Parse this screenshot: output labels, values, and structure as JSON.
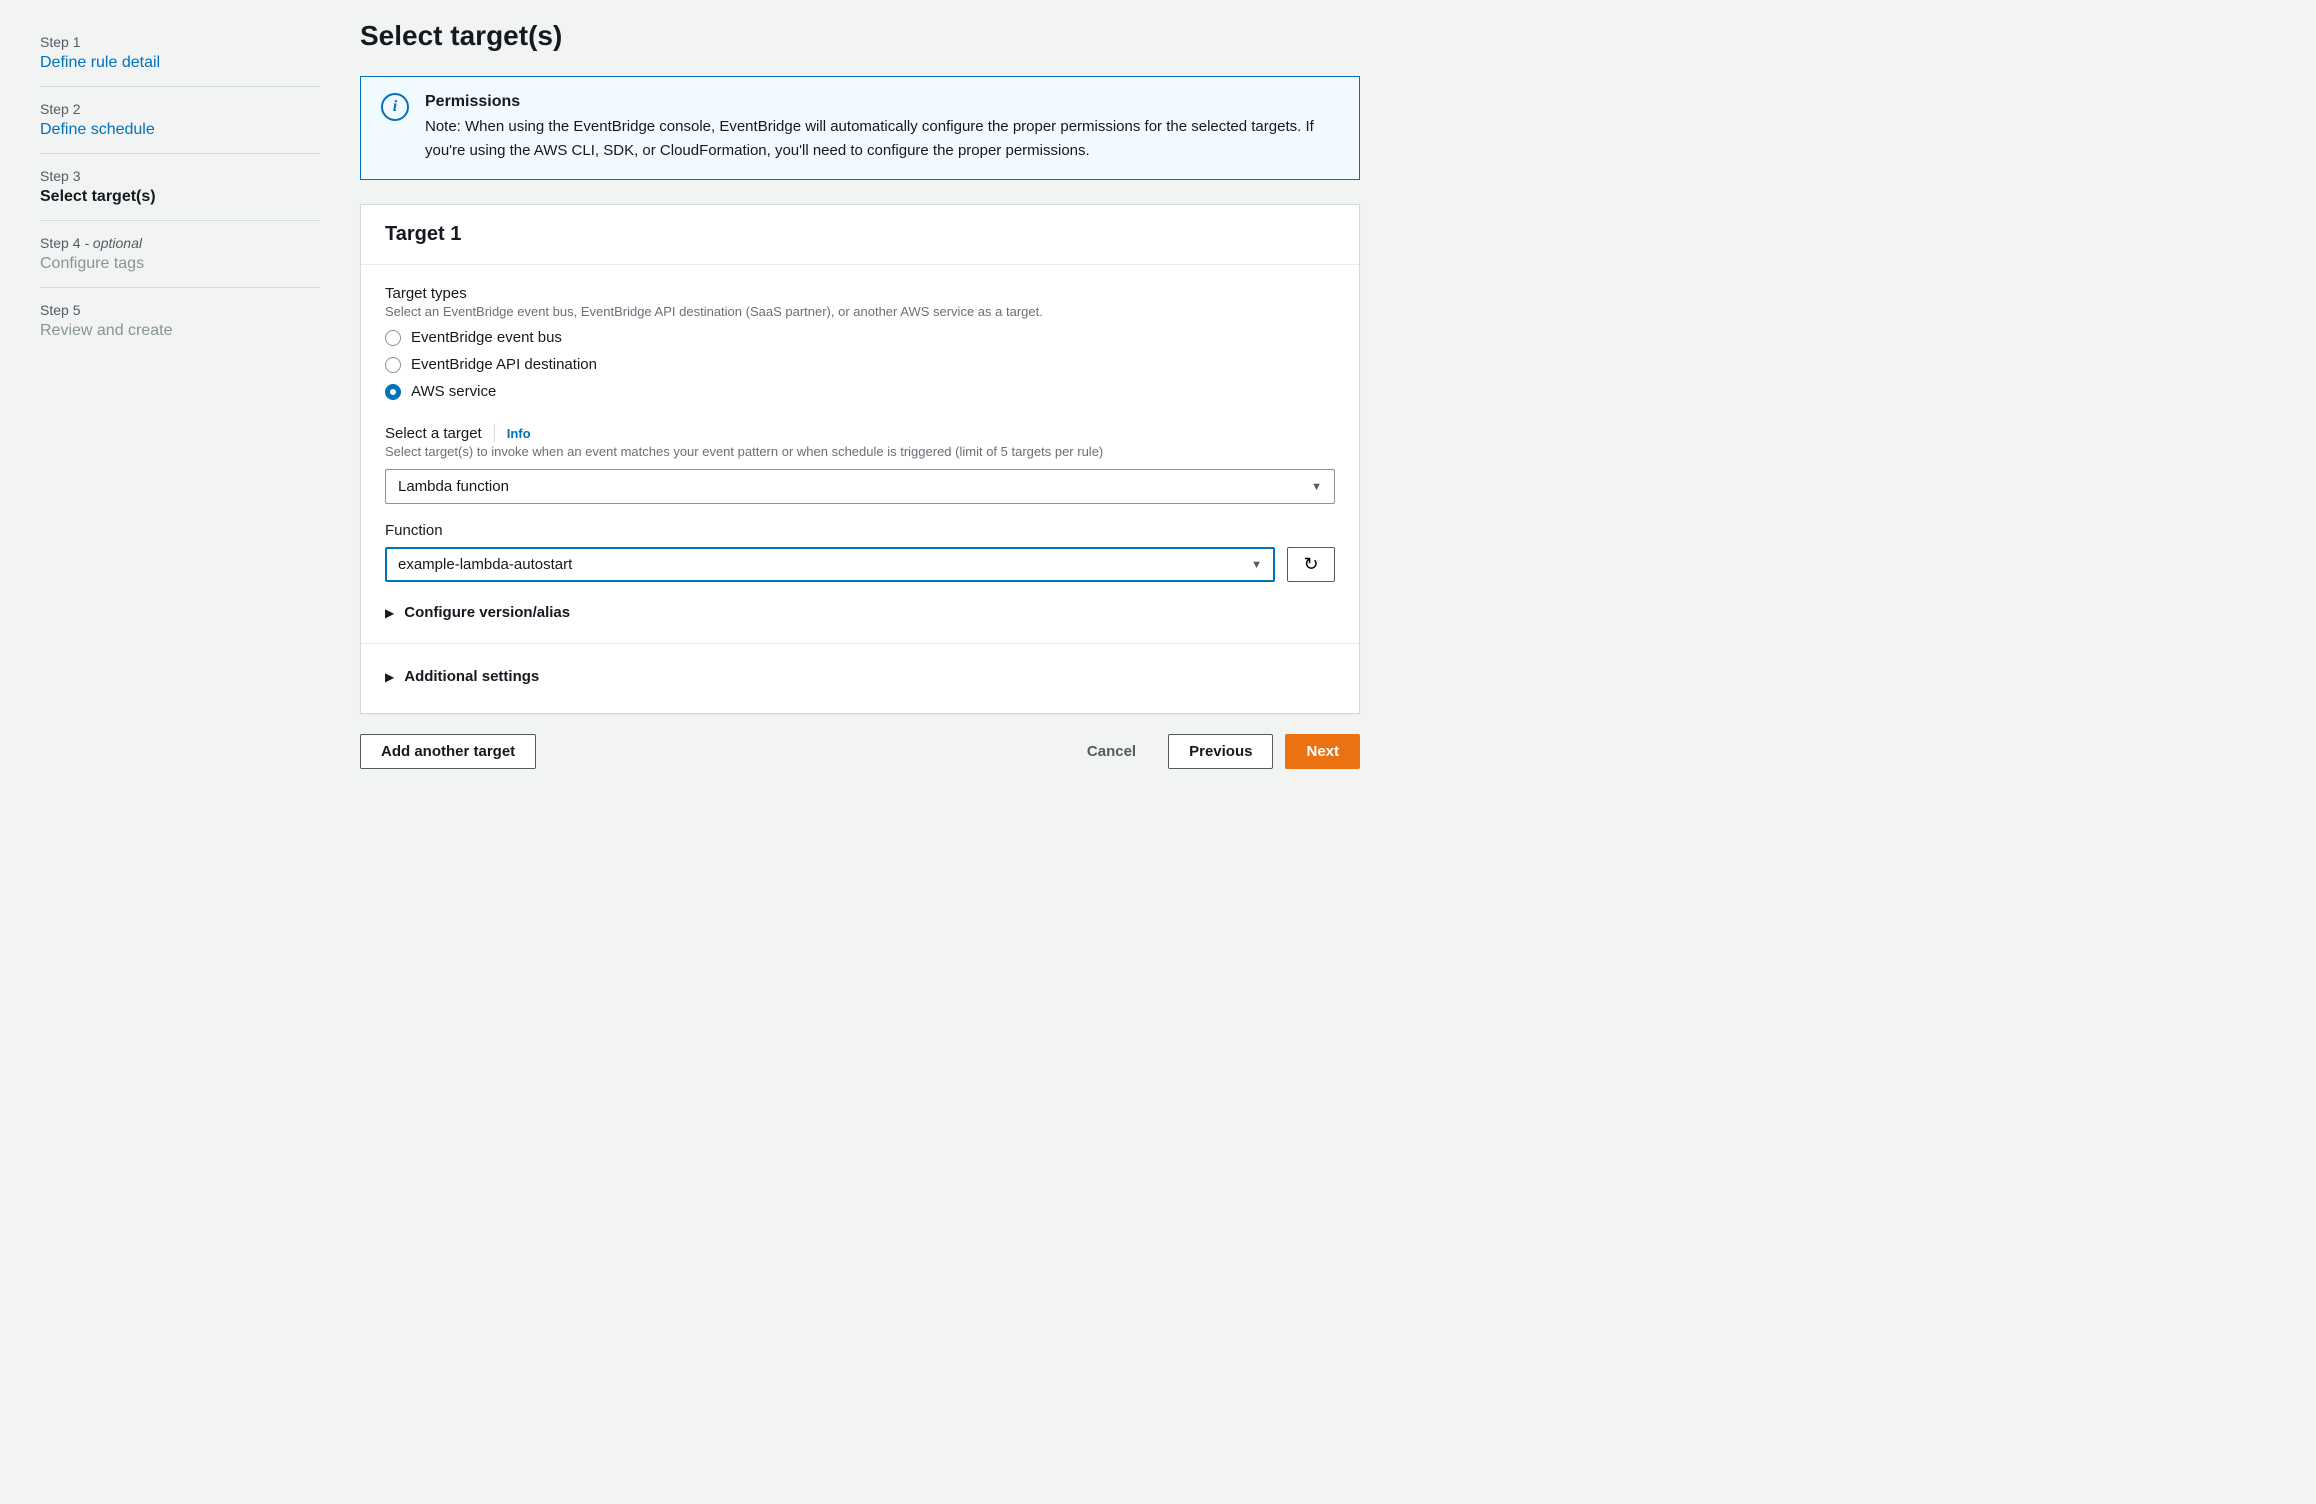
{
  "sidebar": {
    "steps": [
      {
        "label": "Step 1",
        "title": "Define rule detail"
      },
      {
        "label": "Step 2",
        "title": "Define schedule"
      },
      {
        "label": "Step 3",
        "title": "Select target(s)"
      },
      {
        "label_prefix": "Step 4",
        "label_suffix": " - optional",
        "title": "Configure tags"
      },
      {
        "label": "Step 5",
        "title": "Review and create"
      }
    ]
  },
  "page": {
    "title": "Select target(s)"
  },
  "infobox": {
    "title": "Permissions",
    "text": "Note: When using the EventBridge console, EventBridge will automatically configure the proper permissions for the selected targets. If you're using the AWS CLI, SDK, or CloudFormation, you'll need to configure the proper permissions."
  },
  "target_panel": {
    "header": "Target 1",
    "target_types": {
      "title": "Target types",
      "desc": "Select an EventBridge event bus, EventBridge API destination (SaaS partner), or another AWS service as a target.",
      "options": [
        "EventBridge event bus",
        "EventBridge API destination",
        "AWS service"
      ]
    },
    "select_target": {
      "title": "Select a target",
      "info": "Info",
      "desc": "Select target(s) to invoke when an event matches your event pattern or when schedule is triggered (limit of 5 targets per rule)",
      "value": "Lambda function"
    },
    "function": {
      "title": "Function",
      "value": "example-lambda-autostart"
    },
    "configure_version": "Configure version/alias",
    "additional_settings": "Additional settings"
  },
  "footer": {
    "add_another": "Add another target",
    "cancel": "Cancel",
    "previous": "Previous",
    "next": "Next"
  }
}
